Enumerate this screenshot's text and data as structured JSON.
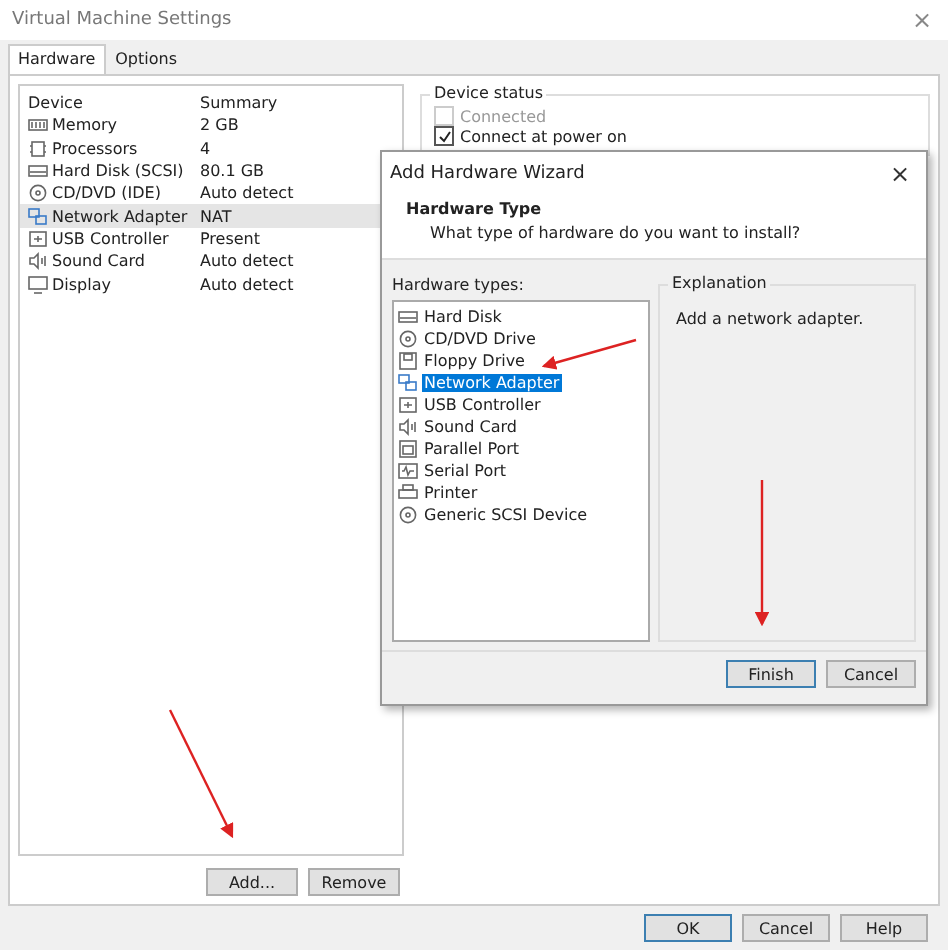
{
  "window": {
    "title": "Virtual Machine Settings",
    "close": "×"
  },
  "tabs": [
    {
      "label": "Hardware",
      "selected": true
    },
    {
      "label": "Options",
      "selected": false
    }
  ],
  "devices": {
    "columns": [
      "Device",
      "Summary"
    ],
    "rows": [
      {
        "kind": "memory",
        "name": "Memory",
        "summary": "2 GB",
        "selected": false
      },
      {
        "kind": "cpu",
        "name": "Processors",
        "summary": "4",
        "selected": false
      },
      {
        "kind": "disk",
        "name": "Hard Disk (SCSI)",
        "summary": "80.1 GB",
        "selected": false
      },
      {
        "kind": "cd",
        "name": "CD/DVD (IDE)",
        "summary": "Auto detect",
        "selected": false
      },
      {
        "kind": "network",
        "name": "Network Adapter",
        "summary": "NAT",
        "selected": true
      },
      {
        "kind": "usb",
        "name": "USB Controller",
        "summary": "Present",
        "selected": false
      },
      {
        "kind": "sound",
        "name": "Sound Card",
        "summary": "Auto detect",
        "selected": false
      },
      {
        "kind": "display",
        "name": "Display",
        "summary": "Auto detect",
        "selected": false
      }
    ]
  },
  "device_buttons": [
    "Add...",
    "Remove"
  ],
  "device_status": {
    "title": "Device status",
    "options": [
      {
        "label": "Connected",
        "checked": false,
        "disabled": true
      },
      {
        "label": "Connect at power on",
        "checked": true,
        "disabled": false
      }
    ]
  },
  "footer_buttons": [
    "OK",
    "Cancel",
    "Help"
  ],
  "wizard": {
    "title": "Add Hardware Wizard",
    "close": "×",
    "heading": "Hardware Type",
    "subheading": "What type of hardware do you want to install?",
    "list_label": "Hardware types:",
    "items": [
      {
        "kind": "disk",
        "label": "Hard Disk",
        "selected": false
      },
      {
        "kind": "cd",
        "label": "CD/DVD Drive",
        "selected": false
      },
      {
        "kind": "floppy",
        "label": "Floppy Drive",
        "selected": false
      },
      {
        "kind": "network",
        "label": "Network Adapter",
        "selected": true
      },
      {
        "kind": "usb",
        "label": "USB Controller",
        "selected": false
      },
      {
        "kind": "sound",
        "label": "Sound Card",
        "selected": false
      },
      {
        "kind": "parallel",
        "label": "Parallel Port",
        "selected": false
      },
      {
        "kind": "serial",
        "label": "Serial Port",
        "selected": false
      },
      {
        "kind": "printer",
        "label": "Printer",
        "selected": false
      },
      {
        "kind": "scsi",
        "label": "Generic SCSI Device",
        "selected": false
      }
    ],
    "explanation_title": "Explanation",
    "explanation": "Add a network adapter.",
    "buttons": [
      "Finish",
      "Cancel"
    ]
  }
}
